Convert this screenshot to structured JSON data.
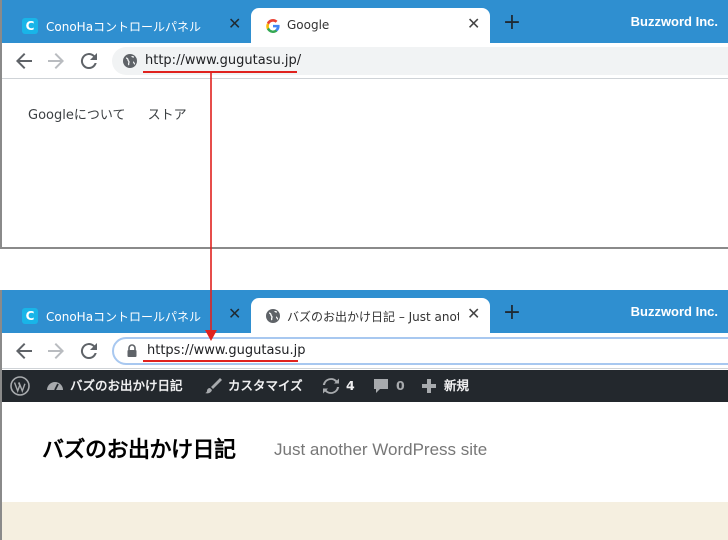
{
  "browser_before": {
    "tabs": [
      {
        "title": "ConoHaコントロールパネル",
        "favicon": "conoha-c-icon",
        "active": false
      },
      {
        "title": "Google",
        "favicon": "google-g-icon",
        "active": true
      }
    ],
    "brand": "Buzzword Inc.",
    "url": "http://www.gugutasu.jp/",
    "security_icon": "globe-info-icon",
    "page_links": [
      "Googleについて",
      "ストア"
    ]
  },
  "browser_after": {
    "tabs": [
      {
        "title": "ConoHaコントロールパネル",
        "favicon": "conoha-c-icon",
        "active": false
      },
      {
        "title": "バズのお出かけ日記 – Just another",
        "favicon": "wordpress-icon",
        "active": true
      }
    ],
    "brand": "Buzzword Inc.",
    "url": "https://www.gugutasu.jp",
    "security_icon": "lock-icon",
    "admin_bar": {
      "site_name": "バズのお出かけ日記",
      "customize": "カスタマイズ",
      "updates_count": "4",
      "comments_count": "0",
      "new_label": "新規"
    },
    "site_title": "バズのお出かけ日記",
    "site_description": "Just another WordPress site"
  },
  "colors": {
    "tabstrip": "#2f8fd0",
    "annotation_red": "#e0221e",
    "admin_bar": "#23282d"
  }
}
